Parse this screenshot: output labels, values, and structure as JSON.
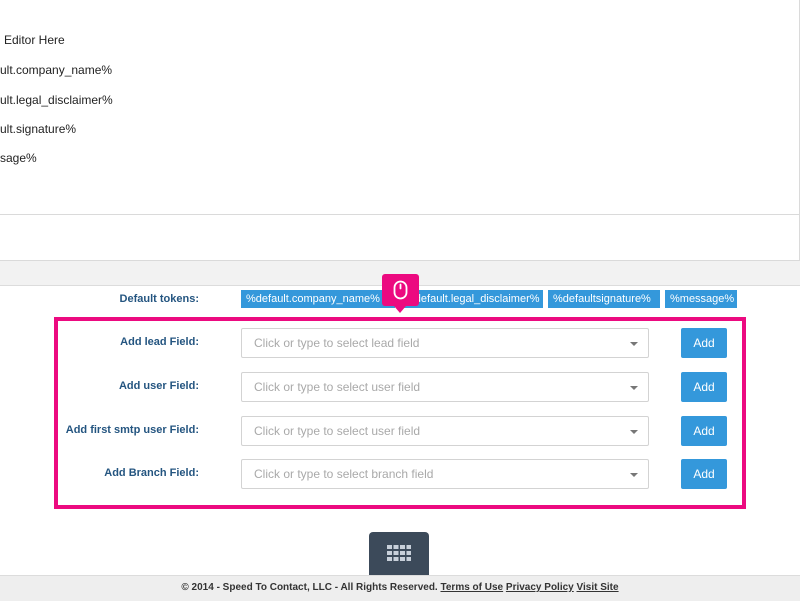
{
  "editor": {
    "lines": [
      "Editor Here",
      "ult.company_name%",
      "ult.legal_disclaimer%",
      "ult.signature%",
      "sage%"
    ]
  },
  "tokens": {
    "label": "Default tokens:",
    "items": [
      "%default.company_name%",
      "%default.legal_disclaimer%",
      "%defaultsignature%",
      "%message%"
    ]
  },
  "fields": [
    {
      "label": "Add lead Field:",
      "placeholder": "Click or type to select lead field",
      "button": "Add"
    },
    {
      "label": "Add user Field:",
      "placeholder": "Click or type to select user field",
      "button": "Add"
    },
    {
      "label": "Add first smtp user Field:",
      "placeholder": "Click or type to select user field",
      "button": "Add"
    },
    {
      "label": "Add Branch Field:",
      "placeholder": "Click or type to select branch field",
      "button": "Add"
    }
  ],
  "footer": {
    "copyright": "© 2014 - Speed To Contact, LLC - All Rights Reserved.",
    "terms": "Terms of Use",
    "privacy": "Privacy Policy",
    "visit": "Visit Site"
  },
  "icons": {
    "cursor_badge": "mouse-icon",
    "grid_button": "grid-icon"
  },
  "colors": {
    "highlight": "#ec0a80",
    "accent": "#3498db",
    "label": "#245580"
  }
}
